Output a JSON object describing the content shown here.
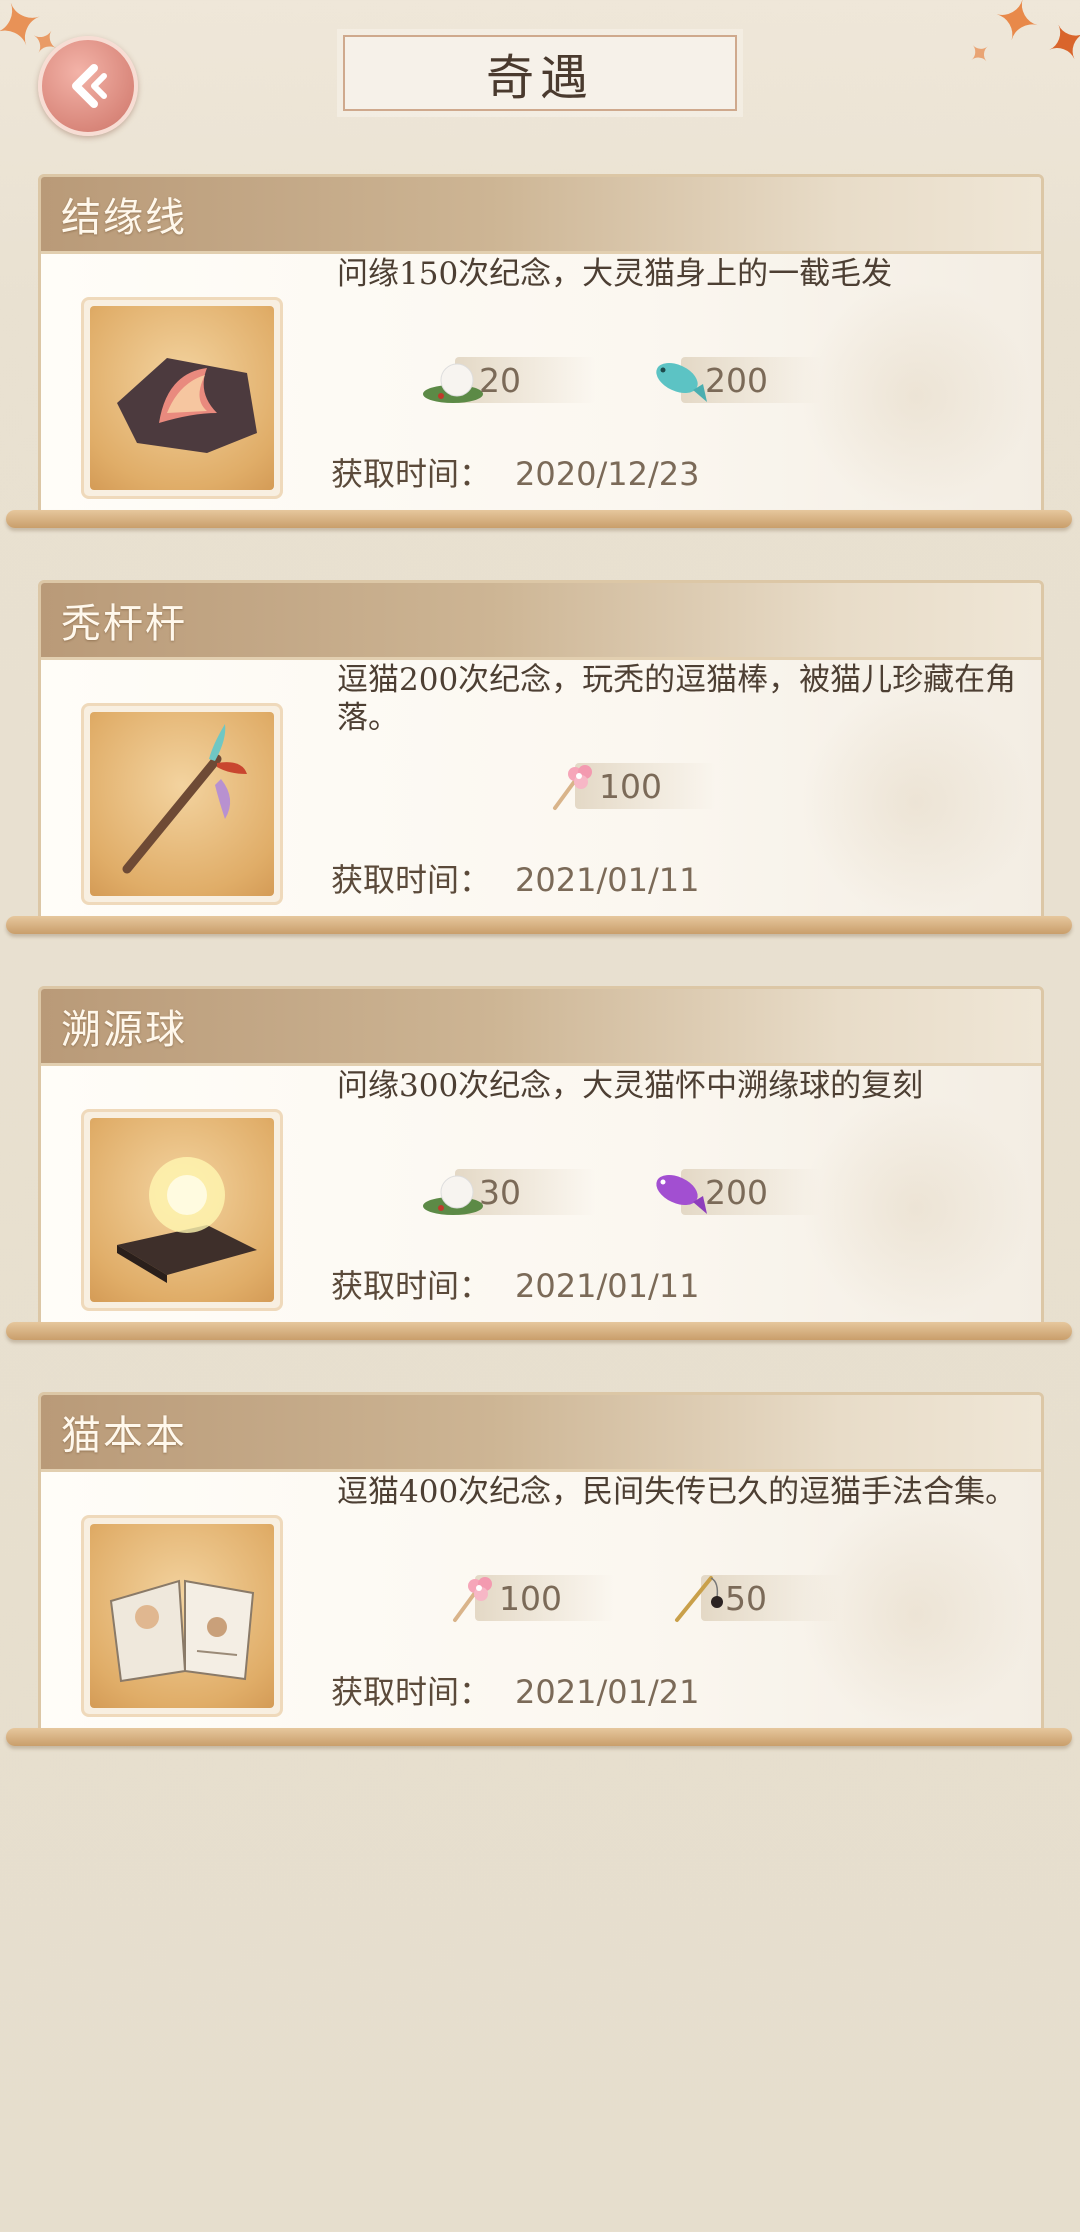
{
  "header": {
    "title": "奇遇"
  },
  "cards": [
    {
      "name": "结缘线",
      "description": "问缘150次纪念，大灵猫身上的一截毛发",
      "item_icon": "fur-tuft-icon",
      "rewards": [
        {
          "icon": "cat-on-leaf-icon",
          "value": "20"
        },
        {
          "icon": "teal-fish-icon",
          "value": "200"
        }
      ],
      "time_label": "获取时间：",
      "date": "2020/12/23"
    },
    {
      "name": "秃杆杆",
      "description": "逗猫200次纪念，玩秃的逗猫棒，被猫儿珍藏在角落。",
      "item_icon": "cat-teaser-wand-icon",
      "rewards": [
        {
          "icon": "pink-flower-wand-icon",
          "value": "100"
        }
      ],
      "time_label": "获取时间：",
      "date": "2021/01/11"
    },
    {
      "name": "溯源球",
      "description": "问缘300次纪念，大灵猫怀中溯缘球的复刻",
      "item_icon": "glowing-orb-icon",
      "rewards": [
        {
          "icon": "cat-on-leaf-icon",
          "value": "30"
        },
        {
          "icon": "purple-fish-icon",
          "value": "200"
        }
      ],
      "time_label": "获取时间：",
      "date": "2021/01/11"
    },
    {
      "name": "猫本本",
      "description": "逗猫400次纪念，民间失传已久的逗猫手法合集。",
      "item_icon": "open-book-icon",
      "rewards": [
        {
          "icon": "pink-flower-wand-icon",
          "value": "100"
        },
        {
          "icon": "fishing-rod-toy-icon",
          "value": "50"
        }
      ],
      "time_label": "获取时间：",
      "date": "2021/01/21"
    }
  ]
}
